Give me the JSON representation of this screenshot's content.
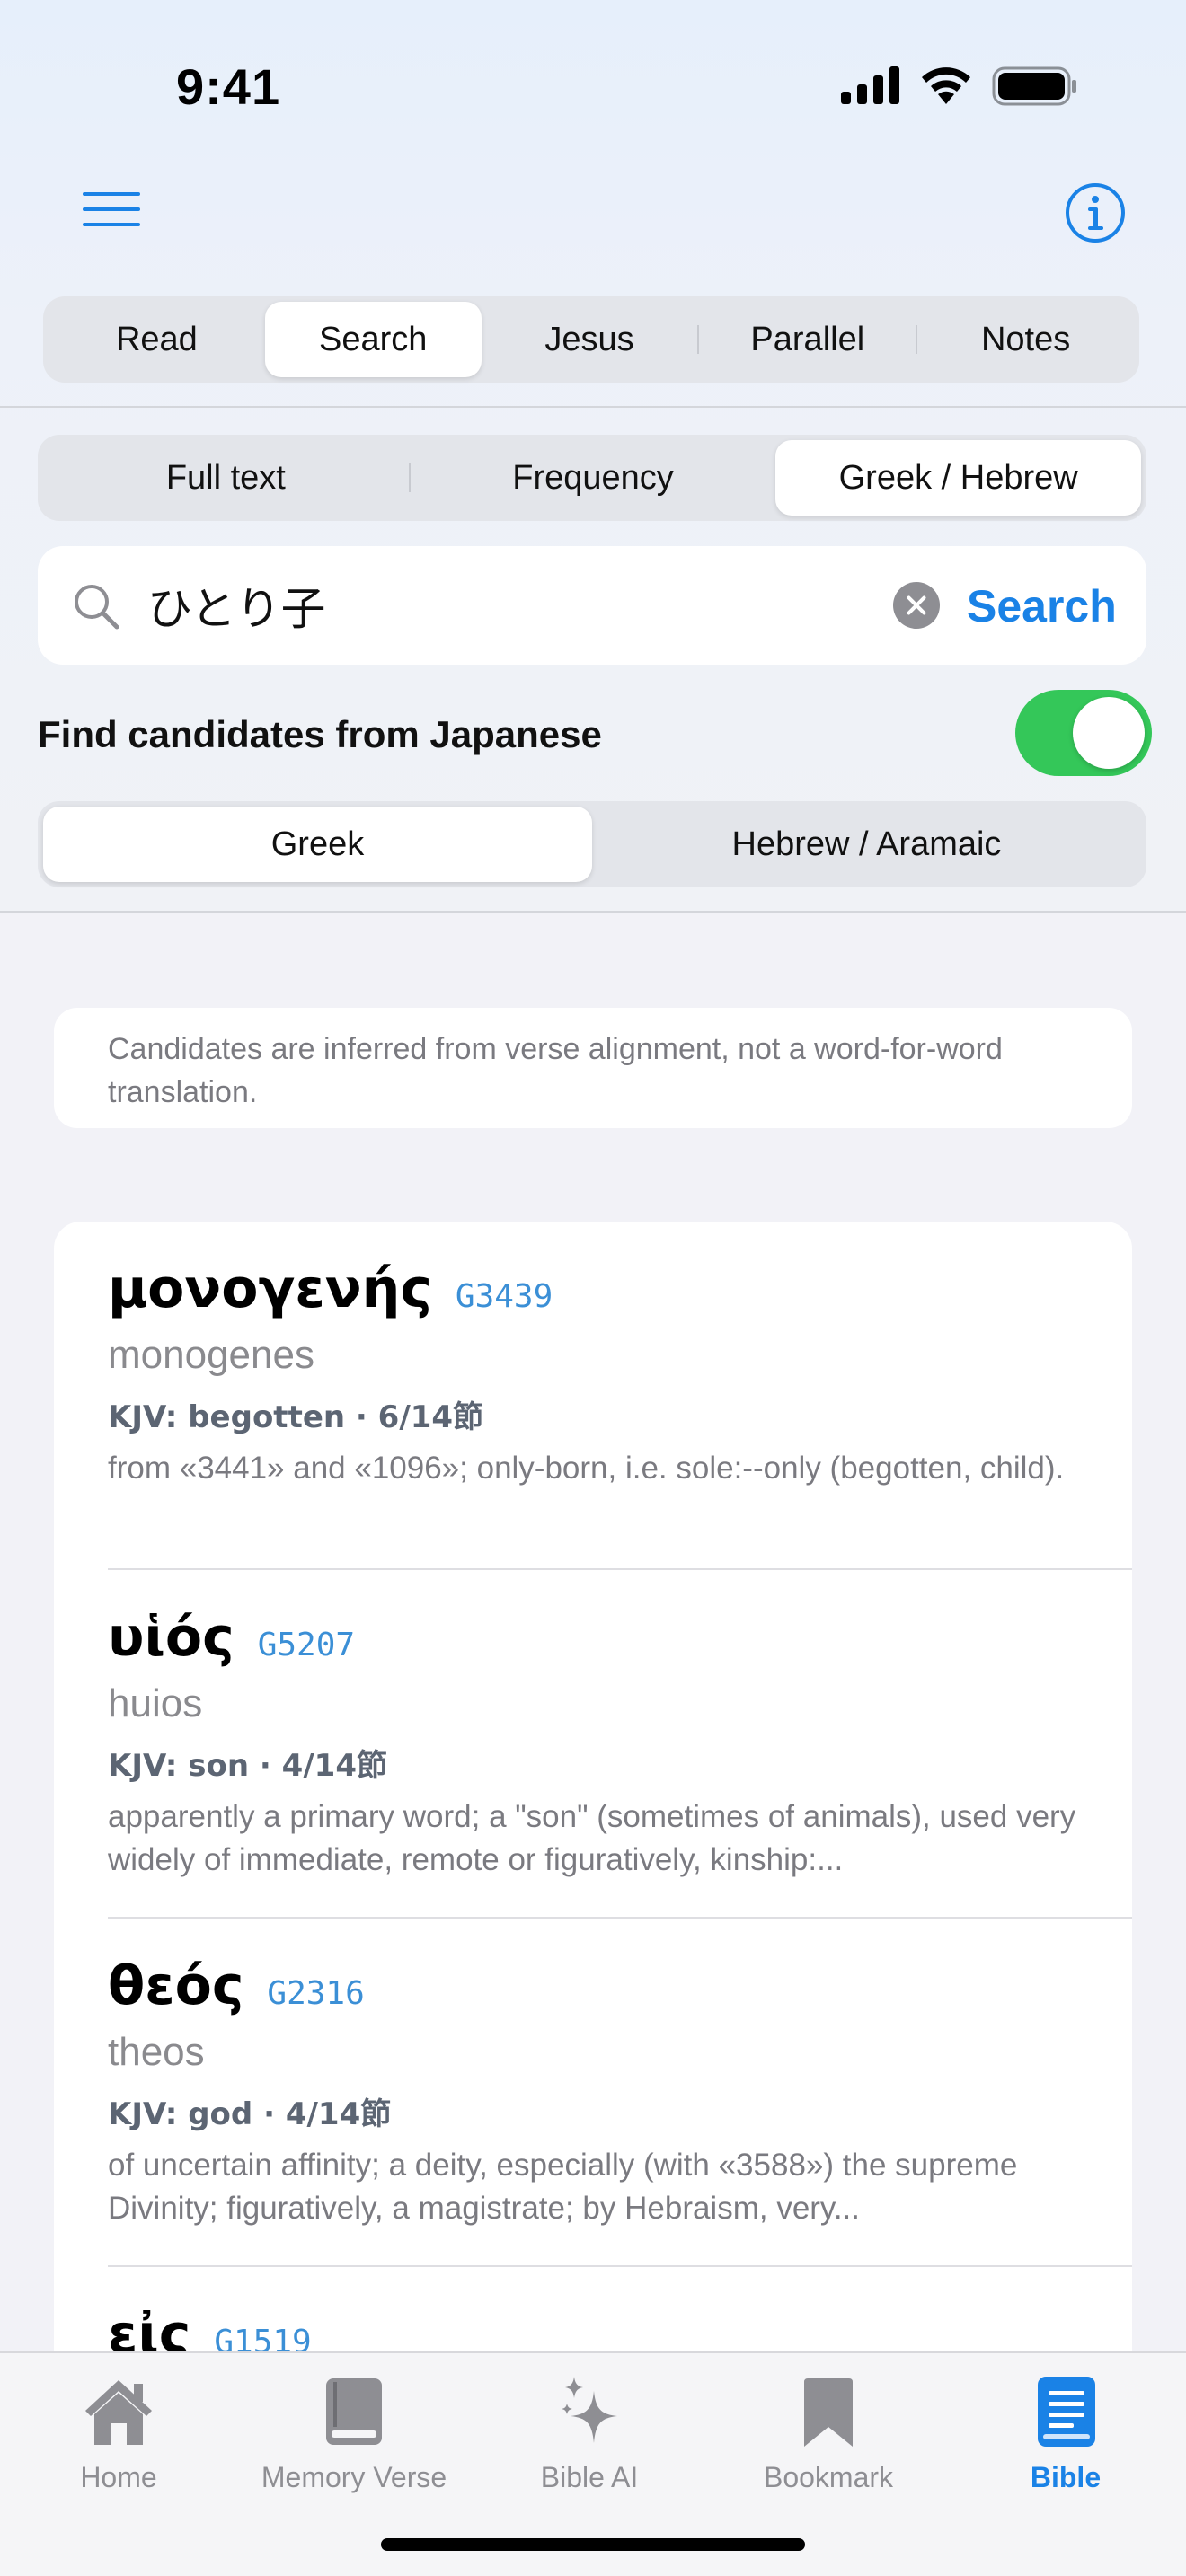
{
  "status_bar": {
    "time": "9:41"
  },
  "main_tabs": [
    {
      "label": "Read",
      "active": false
    },
    {
      "label": "Search",
      "active": true
    },
    {
      "label": "Jesus",
      "active": false
    },
    {
      "label": "Parallel",
      "active": false
    },
    {
      "label": "Notes",
      "active": false
    }
  ],
  "search_modes": [
    {
      "label": "Full text",
      "active": false
    },
    {
      "label": "Frequency",
      "active": false
    },
    {
      "label": "Greek / Hebrew",
      "active": true
    }
  ],
  "search": {
    "query": "ひとり子",
    "button_label": "Search"
  },
  "find_candidates": {
    "label": "Find candidates from Japanese",
    "enabled": true
  },
  "language_modes": [
    {
      "label": "Greek",
      "active": true
    },
    {
      "label": "Hebrew / Aramaic",
      "active": false
    }
  ],
  "note": "Candidates are inferred from verse alignment, not a word-for-word translation.",
  "results": [
    {
      "lemma": "μονογενής",
      "strongs": "G3439",
      "translit": "monogenes",
      "kjv": "KJV: begotten · 6/14節",
      "definition": "from «3441» and «1096»; only-born, i.e. sole:--only (begotten, child)."
    },
    {
      "lemma": "υἱός",
      "strongs": "G5207",
      "translit": "huios",
      "kjv": "KJV: son · 4/14節",
      "definition": "apparently a primary word; a \"son\" (sometimes of animals), used very widely of immediate, remote or figuratively, kinship:..."
    },
    {
      "lemma": "θεός",
      "strongs": "G2316",
      "translit": "theos",
      "kjv": "KJV: god · 4/14節",
      "definition": "of uncertain affinity; a deity, especially (with «3588») the supreme Divinity; figuratively, a magistrate; by Hebraism, very..."
    },
    {
      "lemma": "εἰς",
      "strongs": "G1519"
    }
  ],
  "tab_bar": [
    {
      "label": "Home",
      "icon": "house-icon",
      "active": false
    },
    {
      "label": "Memory Verse",
      "icon": "book-icon",
      "active": false
    },
    {
      "label": "Bible AI",
      "icon": "sparkles-icon",
      "active": false
    },
    {
      "label": "Bookmark",
      "icon": "bookmark-icon",
      "active": false
    },
    {
      "label": "Bible",
      "icon": "bible-icon",
      "active": true
    }
  ],
  "colors": {
    "accent": "#1a82e6",
    "toggle_on": "#34c759",
    "strongs": "#3b8fd6"
  }
}
